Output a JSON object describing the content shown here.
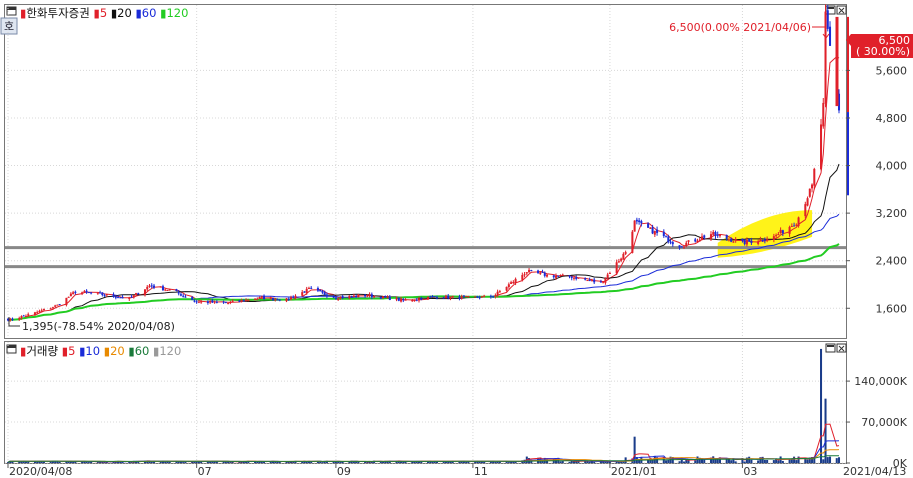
{
  "colors": {
    "up": "#e0202a",
    "down": "#1a2bd8",
    "ma5": "#e0202a",
    "ma20": "#111111",
    "ma60": "#1a2bd8",
    "ma120": "#22cc22",
    "ma10": "#1a2bd8",
    "vol_ma20": "#e88a00",
    "vol_ma60": "#1a7a3a",
    "vol_ma120": "#999999",
    "highlight": "#fff200",
    "support_line": "#888888",
    "price_badge": "#e0202a",
    "volume_bar": "#1a3c8a"
  },
  "price_panel": {
    "corner_icon": "window-icon",
    "legend": {
      "title": "한화투자증권",
      "items": [
        {
          "label": "5",
          "color": "#e0202a"
        },
        {
          "label": "20",
          "color": "#111111"
        },
        {
          "label": "60",
          "color": "#1a2bd8"
        },
        {
          "label": "120",
          "color": "#22cc22"
        }
      ]
    },
    "side_icon_label": "호",
    "high_annotation": "6,500(0.00% 2021/04/06)",
    "low_annotation": "1,395(-78.54% 2020/04/08)",
    "price_badge_line1": "6,500",
    "price_badge_line2": "( 30.00%)"
  },
  "volume_panel": {
    "legend": {
      "title": "거래량",
      "items": [
        {
          "label": "5",
          "color": "#e0202a"
        },
        {
          "label": "10",
          "color": "#1a2bd8"
        },
        {
          "label": "20",
          "color": "#e88a00"
        },
        {
          "label": "60",
          "color": "#1a7a3a"
        },
        {
          "label": "120",
          "color": "#999999"
        }
      ]
    }
  },
  "x_axis": {
    "labels": [
      "2020/04/08",
      "07",
      "09",
      "11",
      "2021/01",
      "03"
    ],
    "end_label": "2021/04/13"
  },
  "chart_data": [
    {
      "type": "candlestick",
      "title": "한화투자증권",
      "period": {
        "start": "2020/04/08",
        "end": "2021/04/13"
      },
      "y_ticks": [
        1600,
        2400,
        3200,
        4000,
        4800,
        5600
      ],
      "y_tick_labels": [
        "1,600",
        "2,400",
        "3,200",
        "4,000",
        "4,800",
        "5,600"
      ],
      "ylim": [
        1100,
        6700
      ],
      "horizontal_support_lines": [
        2300,
        2620
      ],
      "annotations": [
        {
          "text": "6,500(0.00% 2021/04/06)",
          "price": 6500,
          "date": "2021/04/06"
        },
        {
          "text": "1,395(-78.54% 2020/04/08)",
          "price": 1395,
          "date": "2020/04/08"
        }
      ],
      "moving_averages": [
        "5",
        "20",
        "60",
        "120"
      ],
      "close_path": [
        [
          "2020/04/08",
          1395
        ],
        [
          "2020/04/20",
          1520
        ],
        [
          "2020/04/30",
          1650
        ],
        [
          "2020/05/08",
          1880
        ],
        [
          "2020/05/20",
          1830
        ],
        [
          "2020/06/01",
          1760
        ],
        [
          "2020/06/10",
          1980
        ],
        [
          "2020/06/20",
          1900
        ],
        [
          "2020/07/01",
          1710
        ],
        [
          "2020/07/15",
          1690
        ],
        [
          "2020/07/30",
          1780
        ],
        [
          "2020/08/10",
          1740
        ],
        [
          "2020/08/20",
          1920
        ],
        [
          "2020/09/01",
          1780
        ],
        [
          "2020/09/15",
          1820
        ],
        [
          "2020/10/01",
          1730
        ],
        [
          "2020/10/15",
          1790
        ],
        [
          "2020/11/01",
          1780
        ],
        [
          "2020/11/10",
          1800
        ],
        [
          "2020/11/25",
          2220
        ],
        [
          "2020/12/05",
          2150
        ],
        [
          "2020/12/15",
          2130
        ],
        [
          "2020/12/28",
          2020
        ],
        [
          "2021/01/08",
          2550
        ],
        [
          "2021/01/12",
          3050
        ],
        [
          "2021/01/20",
          2900
        ],
        [
          "2021/02/01",
          2650
        ],
        [
          "2021/02/15",
          2850
        ],
        [
          "2021/03/01",
          2700
        ],
        [
          "2021/03/15",
          2800
        ],
        [
          "2021/03/25",
          3050
        ],
        [
          "2021/04/01",
          3650
        ],
        [
          "2021/04/05",
          4700
        ],
        [
          "2021/04/06",
          5000
        ],
        [
          "2021/04/07",
          6500
        ],
        [
          "2021/04/13",
          4950
        ]
      ],
      "last_price": 6500,
      "last_change_pct": 30.0
    },
    {
      "type": "bar",
      "title": "거래량",
      "y_ticks": [
        0,
        70000,
        140000
      ],
      "y_tick_labels": [
        "0K",
        "70,000K",
        "140,000K"
      ],
      "ylim": [
        0,
        200000
      ],
      "moving_averages": [
        "5",
        "10",
        "20",
        "60",
        "120"
      ],
      "spikes": [
        {
          "date": "2021/01/12",
          "value": 45000
        },
        {
          "date": "2021/04/05",
          "value": 195000
        },
        {
          "date": "2021/04/07",
          "value": 110000
        }
      ]
    }
  ]
}
